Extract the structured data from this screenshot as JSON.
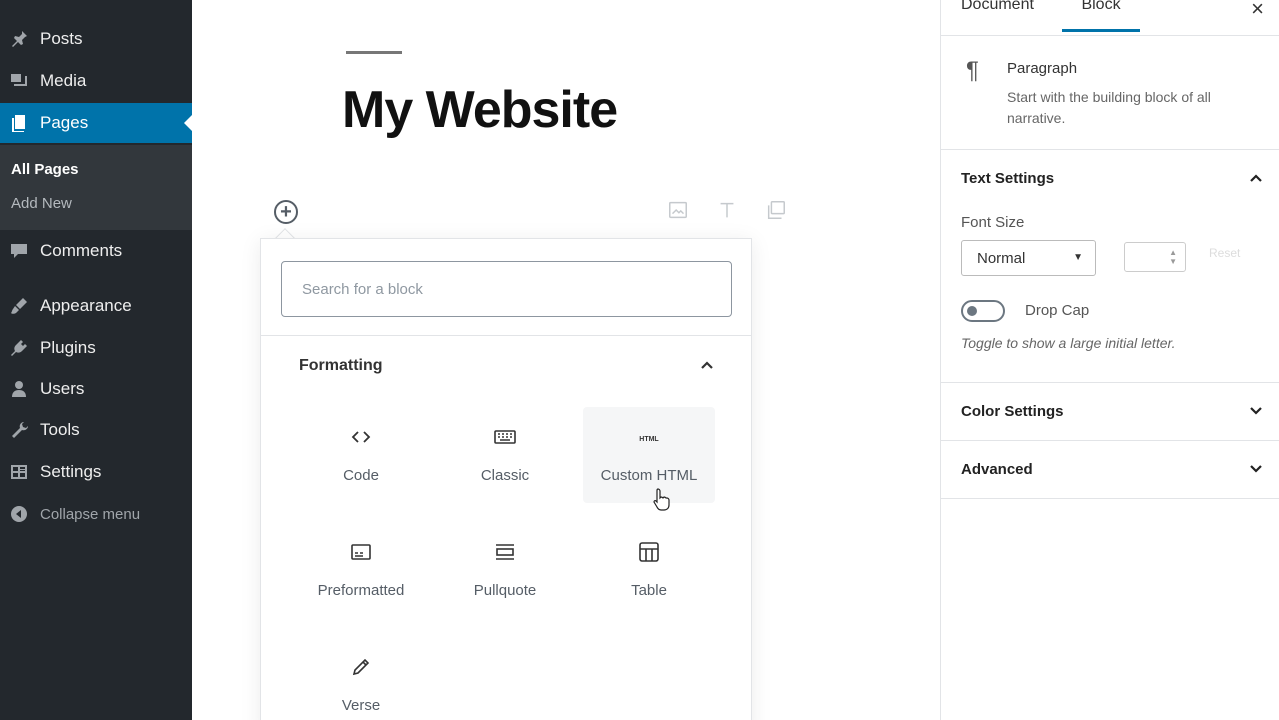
{
  "admin_menu": {
    "items": [
      {
        "label": "Posts",
        "icon": "pin-icon"
      },
      {
        "label": "Media",
        "icon": "media-icon"
      },
      {
        "label": "Pages",
        "icon": "pages-icon"
      },
      {
        "label": "Comments",
        "icon": "comments-icon"
      },
      {
        "label": "Appearance",
        "icon": "paintbrush-icon"
      },
      {
        "label": "Plugins",
        "icon": "plug-icon"
      },
      {
        "label": "Users",
        "icon": "users-icon"
      },
      {
        "label": "Tools",
        "icon": "wrench-icon"
      },
      {
        "label": "Settings",
        "icon": "settings-icon"
      }
    ],
    "submenu": [
      "All Pages",
      "Add New"
    ],
    "collapse_label": "Collapse menu"
  },
  "editor": {
    "title": "My Website"
  },
  "inserter": {
    "search_placeholder": "Search for a block",
    "panel_title": "Formatting",
    "blocks": [
      {
        "label": "Code",
        "icon": "code-icon"
      },
      {
        "label": "Classic",
        "icon": "keyboard-icon"
      },
      {
        "label": "Custom HTML",
        "icon": "html-icon",
        "icon_text": "HTML"
      },
      {
        "label": "Preformatted",
        "icon": "preformatted-icon"
      },
      {
        "label": "Pullquote",
        "icon": "pullquote-icon"
      },
      {
        "label": "Table",
        "icon": "table-icon"
      },
      {
        "label": "Verse",
        "icon": "pencil-icon"
      }
    ]
  },
  "settings_sidebar": {
    "tabs": [
      "Document",
      "Block"
    ],
    "active_tab": "Block",
    "block_card": {
      "title": "Paragraph",
      "description": "Start with the building block of all narrative."
    },
    "text_settings": {
      "title": "Text Settings",
      "font_size_label": "Font Size",
      "font_size_value": "Normal",
      "reset_label": "Reset",
      "drop_cap_label": "Drop Cap",
      "drop_cap_help": "Toggle to show a large initial letter."
    },
    "color_settings_title": "Color Settings",
    "advanced_title": "Advanced"
  },
  "colors": {
    "sidebar_bg": "#23282d",
    "accent": "#0073aa"
  }
}
